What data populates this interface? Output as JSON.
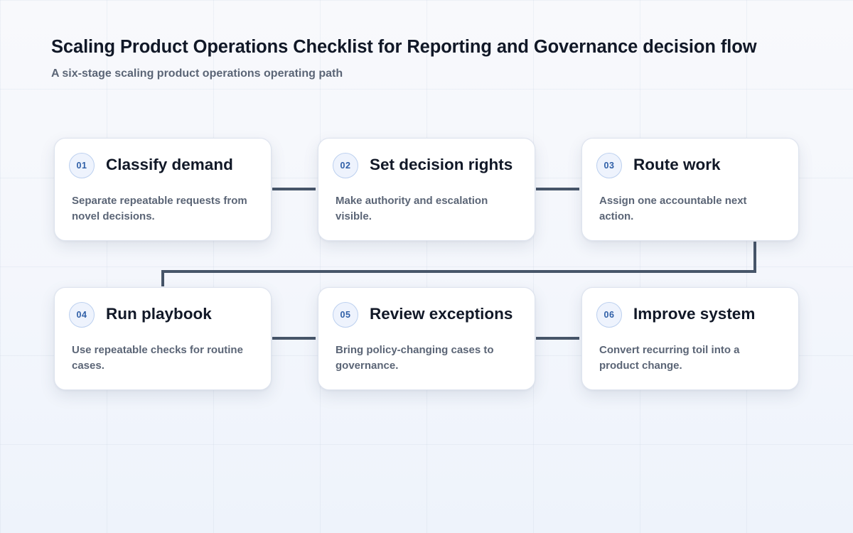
{
  "header": {
    "title": "Scaling Product Operations Checklist for Reporting and Governance decision flow",
    "subtitle": "A six-stage scaling product operations operating path"
  },
  "colors": {
    "connector": "#475569",
    "badge_text": "#2f5fa7",
    "badge_border": "#bcd0ef",
    "card_border": "#dde3ee"
  },
  "steps": [
    {
      "number": "01",
      "title": "Classify demand",
      "description": "Separate repeatable requests from novel decisions."
    },
    {
      "number": "02",
      "title": "Set decision rights",
      "description": "Make authority and escalation visible."
    },
    {
      "number": "03",
      "title": "Route work",
      "description": "Assign one accountable next action."
    },
    {
      "number": "04",
      "title": "Run playbook",
      "description": "Use repeatable checks for routine cases."
    },
    {
      "number": "05",
      "title": "Review exceptions",
      "description": "Bring policy-changing cases to governance."
    },
    {
      "number": "06",
      "title": "Improve system",
      "description": "Convert recurring toil into a product change."
    }
  ]
}
